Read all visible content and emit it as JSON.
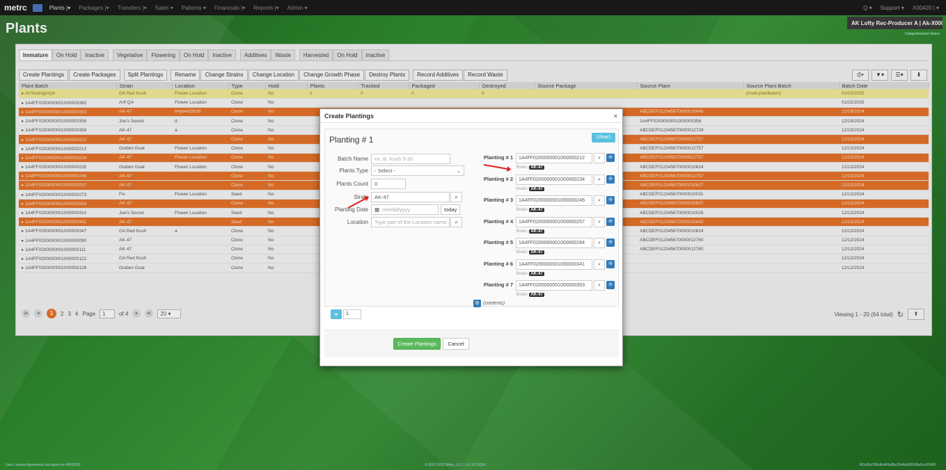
{
  "app": {
    "logo": "metrc",
    "nav": [
      {
        "label": "Plants |▾"
      },
      {
        "label": "Packages |▾"
      },
      {
        "label": "Transfers |▾"
      },
      {
        "label": "Sales ▾"
      },
      {
        "label": "Patients ▾"
      },
      {
        "label": "Financials |▾"
      },
      {
        "label": "Reports |▾"
      },
      {
        "label": "Admin ▾"
      }
    ],
    "search_label": "Q ▾",
    "support": "Support ▾",
    "user": "X00420 | ▾",
    "facility": "AK Lofty Rec-Producer A | Ak-X0001 ▾",
    "compliance": "Comprehensive Demo"
  },
  "page": {
    "title": "Plants"
  },
  "tabs": {
    "group1": [
      "Immature",
      "On Hold",
      "Inactive"
    ],
    "group2": [
      "Vegetative",
      "Flowering",
      "On Hold",
      "Inactive"
    ],
    "group3": [
      "Additives",
      "Waste"
    ],
    "group4": [
      "Harvested",
      "On Hold",
      "Inactive"
    ]
  },
  "toolbar": {
    "buttons": [
      "Create Plantings",
      "Create Packages",
      "Split Plantings",
      "Rename",
      "Change Strains",
      "Change Location",
      "Change Growth Phase",
      "Destroy Plants",
      "Record Additives",
      "Record Waste"
    ],
    "right": [
      "⎙▾",
      "▼▾",
      "☰▾",
      "⬇"
    ]
  },
  "grid": {
    "headers": [
      "Plant Batch",
      "Strain",
      "Location",
      "Type",
      "Hold",
      "Plants",
      "Tracked",
      "Packaged",
      "Destroyed",
      "Source Package",
      "Source Plant",
      "Source Plant Batch",
      "Batch Date"
    ],
    "rows": [
      {
        "style": "y",
        "cells": [
          "▸ ArtTestingInQA",
          "GA Red Kush",
          "Flower Location",
          "Clone",
          "No",
          "1",
          "0",
          "0",
          "0",
          "",
          "",
          "(multi-plantbatch)",
          "01/03/2025"
        ]
      },
      {
        "style": "w",
        "cells": [
          "▸ 1A4FF0200000001000000360",
          "Arif QA",
          "Flower Location",
          "Clone",
          "No",
          "",
          "",
          "",
          "",
          "",
          "",
          "",
          "01/02/2025"
        ]
      },
      {
        "style": "o",
        "cells": [
          "▸ 1A4FF0200000001000000353",
          "AK-47",
          "64yb4d2fb35",
          "Clone",
          "No",
          "",
          "",
          "",
          "",
          "",
          "ABCDEF012345670000010648",
          "",
          "12/19/2024"
        ]
      },
      {
        "style": "w",
        "cells": [
          "▸ 1A4FF0200000001000000356",
          "Joe's Secret",
          "d",
          "Clone",
          "No",
          "",
          "",
          "",
          "",
          "",
          "1A4FF0200000001000000356",
          "",
          "12/19/2024"
        ]
      },
      {
        "style": "w",
        "cells": [
          "▸ 1A4FF0200000001000000359",
          "AK-47",
          "a",
          "Clone",
          "No",
          "",
          "",
          "",
          "",
          "",
          "ABCDEF012345670000012729",
          "",
          "12/19/2024"
        ]
      },
      {
        "style": "o",
        "cells": [
          "▸ 1A4FF0200000001000000212",
          "AK-47",
          "",
          "Clone",
          "No",
          "",
          "",
          "",
          "",
          "",
          "ABCDEF012345670000012757",
          "",
          "12/13/2024"
        ]
      },
      {
        "style": "w",
        "cells": [
          "▸ 1A4FF0200000001000000213",
          "Golden Goat",
          "Flower Location",
          "Clone",
          "No",
          "",
          "",
          "",
          "",
          "",
          "ABCDEF012345670000012757",
          "",
          "12/13/2024"
        ]
      },
      {
        "style": "o",
        "cells": [
          "▸ 1A4FF0200000001000000234",
          "AK-47",
          "Flower Location",
          "Clone",
          "No",
          "",
          "",
          "",
          "",
          "",
          "ABCDEF012345670000012757",
          "",
          "12/13/2024"
        ]
      },
      {
        "style": "w",
        "cells": [
          "▸ 1A4FF0200000001000000235",
          "Golden Goat",
          "Flower Location",
          "Clone",
          "No",
          "",
          "",
          "",
          "",
          "",
          "ABCDEF012345670000010624",
          "",
          "12/13/2024"
        ]
      },
      {
        "style": "o",
        "cells": [
          "▸ 1A4FF0200000001000000246",
          "AK-47",
          "",
          "Clone",
          "No",
          "",
          "",
          "",
          "",
          "",
          "ABCDEF012345670000012757",
          "",
          "12/13/2024"
        ]
      },
      {
        "style": "o",
        "cells": [
          "▸ 1A4FF0200000001000000257",
          "AK-47",
          "",
          "Clone",
          "No",
          "",
          "",
          "",
          "",
          "",
          "ABCDEF012345670000010627",
          "",
          "12/13/2024"
        ]
      },
      {
        "style": "w",
        "cells": [
          "▸ 1A4FF0200000001000000273",
          "Fiv",
          "Flower Location",
          "Seed",
          "No",
          "",
          "",
          "",
          "",
          "",
          "ABCDEF012345670000010031",
          "",
          "12/13/2024"
        ]
      },
      {
        "style": "o",
        "cells": [
          "▸ 1A4FF0200000001000000284",
          "AK-47",
          "",
          "Clone",
          "No",
          "",
          "",
          "",
          "",
          "",
          "ABCDEF012345670000010627",
          "",
          "12/13/2024"
        ]
      },
      {
        "style": "w",
        "cells": [
          "▸ 1A4FF0200000001000000310",
          "Joe's Secret",
          "Flower Location",
          "Seed",
          "No",
          "",
          "",
          "",
          "",
          "",
          "ABCDEF012345670000010026",
          "",
          "12/13/2024"
        ]
      },
      {
        "style": "o",
        "cells": [
          "▸ 1A4FF0200000001000000341",
          "AK-47",
          "",
          "Seed",
          "No",
          "",
          "",
          "",
          "",
          "",
          "ABCDEF012345670000010645",
          "",
          "12/13/2024"
        ]
      },
      {
        "style": "w",
        "cells": [
          "▸ 1A4FF0200000001000000347",
          "GA Red Kush",
          "a",
          "Clone",
          "No",
          "",
          "",
          "",
          "",
          "",
          "ABCDEF012345670000010624",
          "",
          "12/13/2024"
        ]
      },
      {
        "style": "w",
        "cells": [
          "▸ 1A4FF0200000001000000090",
          "AK-47",
          "",
          "Clone",
          "No",
          "",
          "",
          "",
          "",
          "",
          "ABCDEF012345670000012760",
          "",
          "12/12/2024"
        ]
      },
      {
        "style": "w",
        "cells": [
          "▸ 1A4FF0200000001000000111",
          "AK-47",
          "",
          "Clone",
          "No",
          "",
          "",
          "",
          "",
          "",
          "ABCDEF012345670000012760",
          "",
          "12/12/2024"
        ]
      },
      {
        "style": "w",
        "cells": [
          "▸ 1A4FF0200000001000000122",
          "GA Red Kush",
          "",
          "Clone",
          "No",
          "",
          "",
          "",
          "",
          "",
          "",
          "",
          "12/12/2024"
        ]
      },
      {
        "style": "w",
        "cells": [
          "▸ 1A4FF0200000001000000126",
          "Golden Goat",
          "",
          "Clone",
          "No",
          "",
          "",
          "",
          "",
          "",
          "",
          "",
          "12/12/2024"
        ]
      }
    ]
  },
  "pager": {
    "first": "|◂",
    "prev": "◂",
    "current": "1",
    "pages": [
      "2",
      "3",
      "4"
    ],
    "page_label": "Page",
    "page_value": "1",
    "of_label": "of 4",
    "next": "▸",
    "last": "▸|",
    "page_size": "20 ▾",
    "viewing": "Viewing 1 - 20 (64 total)",
    "refresh": "↻",
    "upload": "⬆"
  },
  "modal": {
    "title": "Create Plantings",
    "close": "×",
    "planting_label": "Planting # 1",
    "clear": "(clear)",
    "fields": {
      "batch_name_label": "Batch Name",
      "batch_name_placeholder": "ex. B. Kush 5-30",
      "plants_type_label": "Plants Type",
      "plants_type_value": "- Select -",
      "plants_count_label": "Plants Count",
      "plants_count_value": "0",
      "strain_label": "Strain",
      "strain_value": "AK-47",
      "planting_date_label": "Planting Date",
      "planting_date_placeholder": "mm/dd/yyyy",
      "today": "today",
      "location_label": "Location",
      "location_placeholder": "Type part of the Location name..."
    },
    "plantings": [
      {
        "label": "Planting # 1",
        "value": "1A4FF0200000001000000212",
        "strain_prefix": "Strain:",
        "strain": "AK-47"
      },
      {
        "label": "Planting # 2",
        "value": "1A4FF0200000001000000234",
        "strain_prefix": "Strain:",
        "strain": "AK-47"
      },
      {
        "label": "Planting # 3",
        "value": "1A4FF0200000001000000246",
        "strain_prefix": "Strain:",
        "strain": "AK-47"
      },
      {
        "label": "Planting # 4",
        "value": "1A4FF0200000001000000257",
        "strain_prefix": "Strain:",
        "strain": "AK-47"
      },
      {
        "label": "Planting # 5",
        "value": "1A4FF0200000001000000284",
        "strain_prefix": "Strain:",
        "strain": "AK-47"
      },
      {
        "label": "Planting # 6",
        "value": "1A4FF0200000001000000341",
        "strain_prefix": "Strain:",
        "strain": "AK-47"
      },
      {
        "label": "Planting # 7",
        "value": "1A4FF0200000001000000353",
        "strain_prefix": "Strain:",
        "strain": "AK-47"
      }
    ],
    "contents": "(contents)",
    "add_count": "1",
    "create_button": "Create Plantings",
    "cancel_button": "Cancel"
  },
  "footer": {
    "left": "User License Agreement (accepted on 4/8/2025)",
    "center": "© 2012-2025 Metrc, LLC. | v1.16.25314",
    "right": "f60c0bd708c6b443a8bc0544a9820d9a2ce0f1490"
  },
  "colors": {
    "orange_row": "#e8742a",
    "yellow_row": "#f4ec9a",
    "accent_blue": "#337ab7",
    "info_blue": "#5bc0de",
    "success_green": "#5cb85c",
    "annotation_red": "#e0201c"
  }
}
